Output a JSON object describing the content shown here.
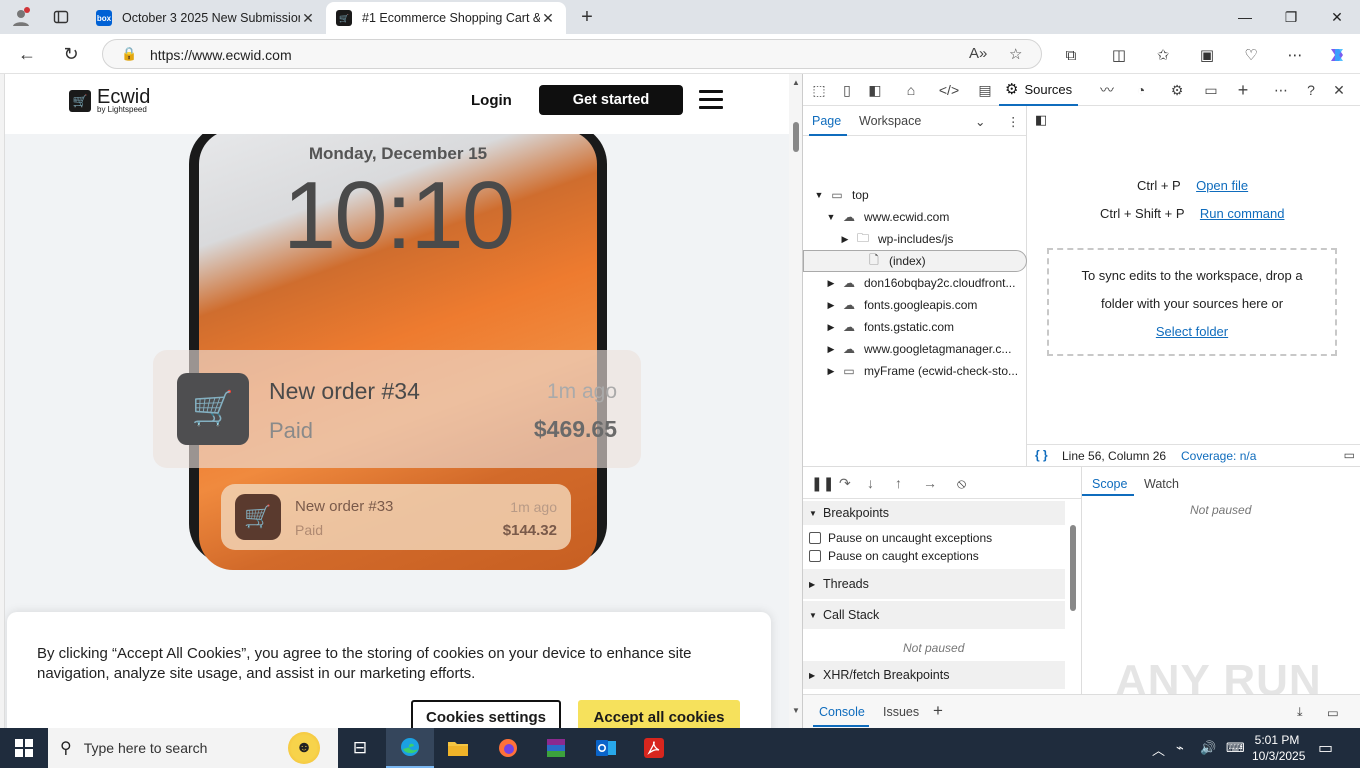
{
  "browser": {
    "tabs": [
      {
        "title": "October 3 2025 New Submission",
        "favicon": "box-icon",
        "favicon_color": "#0061d5"
      },
      {
        "title": "#1 Ecommerce Shopping Cart & O",
        "favicon": "ecwid-cart-icon",
        "favicon_color": "#1a1a1a"
      }
    ],
    "new_tab_label": "+",
    "url": "https://www.ecwid.com"
  },
  "site": {
    "logo_name": "Ecwid",
    "logo_sub": "by Lightspeed",
    "login_label": "Login",
    "get_started_label": "Get started",
    "phone_date": "Monday, December 15",
    "phone_time": "10:10",
    "notifications": [
      {
        "title": "New order #34",
        "status": "Paid",
        "time": "1m ago",
        "amount": "$469.65"
      },
      {
        "title": "New order #33",
        "status": "Paid",
        "time": "1m ago",
        "amount": "$144.32"
      }
    ],
    "cookie_text": "By clicking “Accept All Cookies”, you agree to the storing of cookies on your device to enhance site navigation, analyze site usage, and assist in our marketing efforts.",
    "cookie_settings_label": "Cookies settings",
    "accept_cookies_label": "Accept all cookies"
  },
  "devtools": {
    "active_tab": "Sources",
    "nav_tabs": [
      "Page",
      "Workspace"
    ],
    "tree": [
      {
        "label": "top",
        "icon": "frame-icon",
        "expand": "▼"
      },
      {
        "label": "www.ecwid.com",
        "icon": "cloud-icon",
        "expand": "▼"
      },
      {
        "label": "wp-includes/js",
        "icon": "folder-icon",
        "expand": "▶"
      },
      {
        "label": "(index)",
        "icon": "file-icon",
        "expand": ""
      },
      {
        "label": "don16obqbay2c.cloudfront...",
        "icon": "cloud-icon",
        "expand": "▶"
      },
      {
        "label": "fonts.googleapis.com",
        "icon": "cloud-icon",
        "expand": "▶"
      },
      {
        "label": "fonts.gstatic.com",
        "icon": "cloud-icon",
        "expand": "▶"
      },
      {
        "label": "www.googletagmanager.c...",
        "icon": "cloud-icon",
        "expand": "▶"
      },
      {
        "label": "myFrame (ecwid-check-sto...",
        "icon": "frame-icon",
        "expand": "▶"
      }
    ],
    "shortcuts": [
      {
        "keys": "Ctrl + P",
        "action": "Open file"
      },
      {
        "keys": "Ctrl + Shift + P",
        "action": "Run command"
      }
    ],
    "workspace_text": "To sync edits to the workspace, drop a folder with your sources here or",
    "select_folder_label": "Select folder",
    "status_braces": "{ }",
    "status_position": "Line 56, Column 26",
    "status_coverage": "Coverage: n/a",
    "breakpoints_label": "Breakpoints",
    "pause_uncaught": "Pause on uncaught exceptions",
    "pause_caught": "Pause on caught exceptions",
    "threads_label": "Threads",
    "call_stack_label": "Call Stack",
    "not_paused": "Not paused",
    "xhr_label": "XHR/fetch Breakpoints",
    "scope_tabs": [
      "Scope",
      "Watch"
    ],
    "drawer_tabs": [
      "Console",
      "Issues"
    ],
    "drawer_add": "+"
  },
  "watermark": "ANY RUN",
  "taskbar": {
    "search_placeholder": "Type here to search",
    "time": "5:01 PM",
    "date": "10/3/2025",
    "apps": [
      "task-view-icon",
      "edge-icon",
      "file-explorer-icon",
      "firefox-icon",
      "winrar-icon",
      "outlook-icon",
      "acrobat-icon"
    ]
  },
  "colors": {
    "accent": "#0f6cbd",
    "cookie_accept": "#f6e15c",
    "taskbar": "#1f2c3d"
  }
}
